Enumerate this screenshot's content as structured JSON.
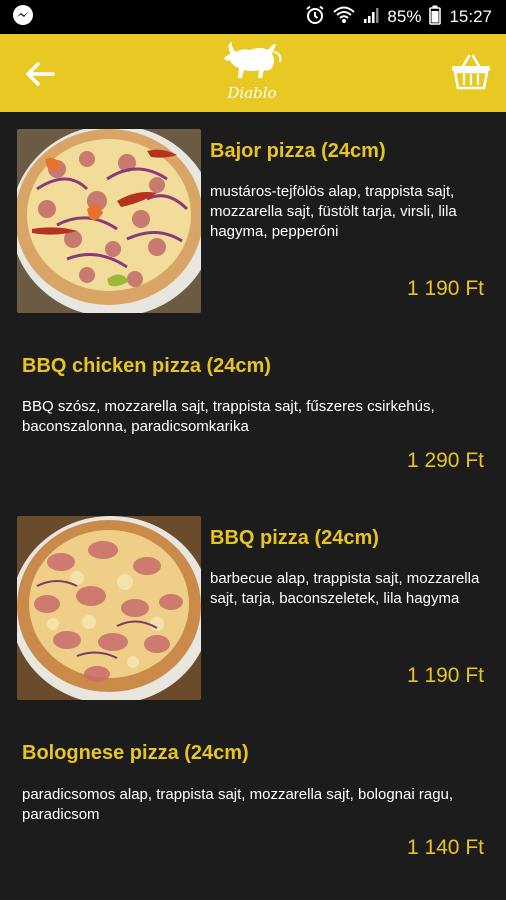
{
  "status_bar": {
    "battery": "85%",
    "time": "15:27",
    "icons": [
      "messenger-icon",
      "alarm-icon",
      "wifi-icon",
      "signal-icon",
      "battery-icon"
    ]
  },
  "app_bar": {
    "logo_text": "Diablo",
    "background": "#e8c822"
  },
  "accent_color": "#e7c424",
  "items": [
    {
      "title": "Bajor pizza (24cm)",
      "desc": "mustáros-tejfölös alap, trappista sajt, mozzarella sajt, füstölt tarja, virsli, lila hagyma, pepperóni",
      "price": "1 190 Ft",
      "has_photo": true
    },
    {
      "title": "BBQ chicken pizza (24cm)",
      "desc": "BBQ szósz, mozzarella sajt, trappista sajt, fűszeres csirkehús, baconszalonna, paradicsomkarika",
      "price": "1 290 Ft",
      "has_photo": false
    },
    {
      "title": "BBQ pizza (24cm)",
      "desc": "barbecue alap, trappista sajt, mozzarella sajt, tarja, baconszeletek, lila hagyma",
      "price": "1 190 Ft",
      "has_photo": true
    },
    {
      "title": "Bolognese pizza (24cm)",
      "desc": "paradicsomos alap, trappista sajt, mozzarella sajt, bolognai ragu, paradicsom",
      "price": "1 140 Ft",
      "has_photo": false
    }
  ]
}
